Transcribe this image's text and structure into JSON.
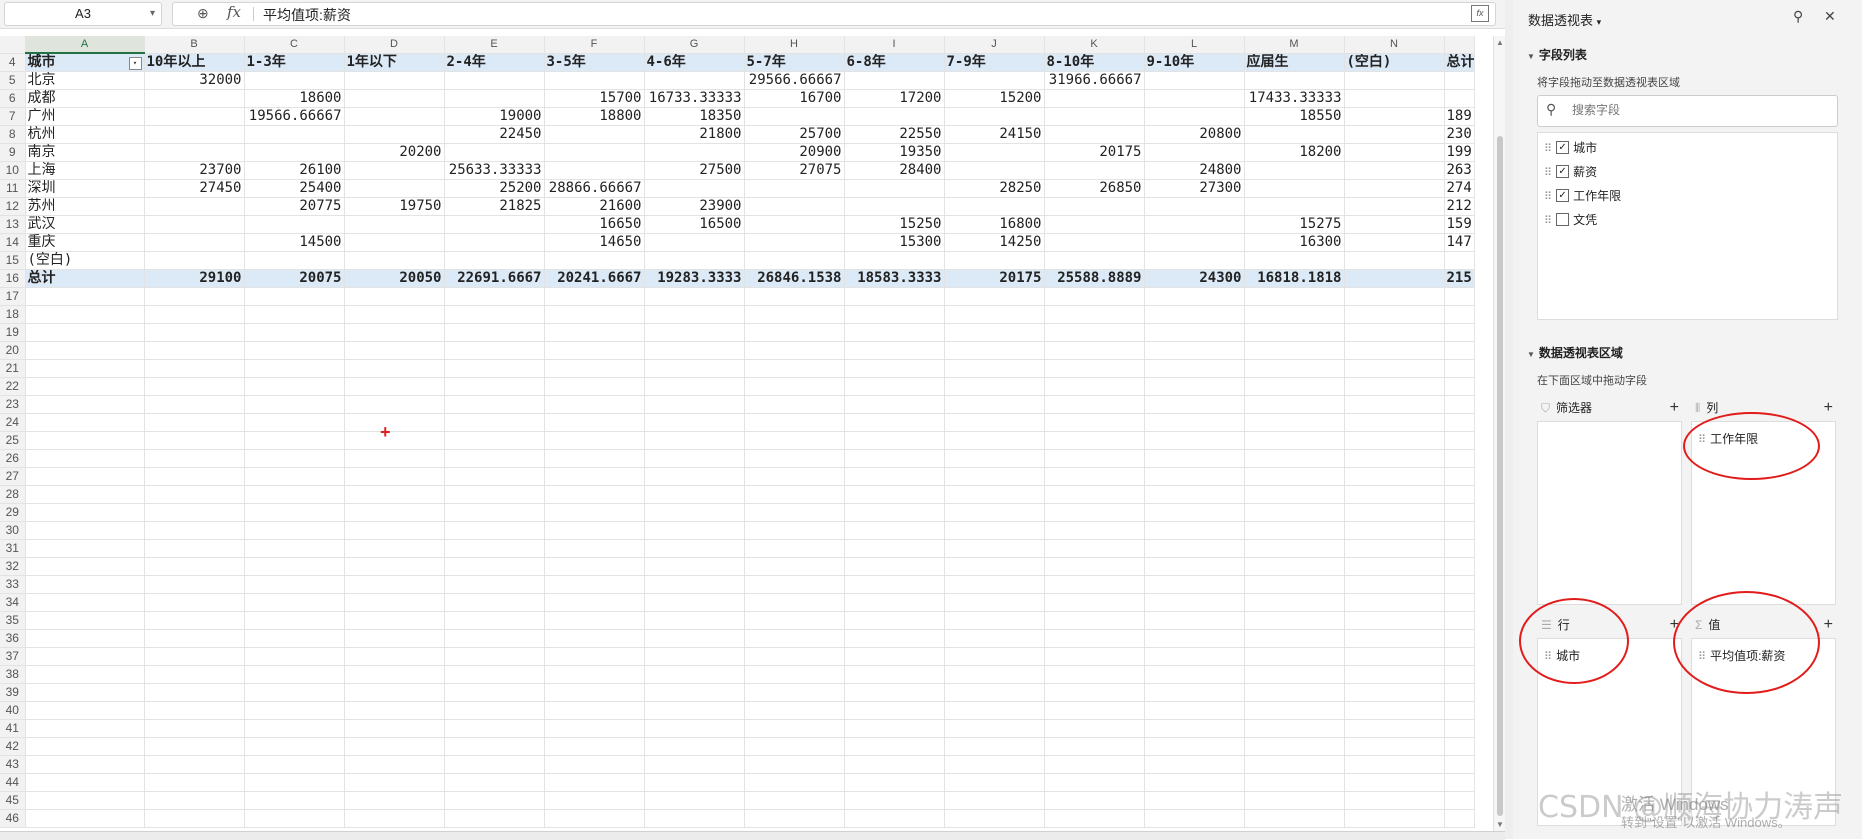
{
  "formula_bar": {
    "cell_ref": "A3",
    "formula": "平均值项:薪资"
  },
  "columns": [
    "A",
    "B",
    "C",
    "D",
    "E",
    "F",
    "G",
    "H",
    "I",
    "J",
    "K",
    "L",
    "M",
    "N",
    ""
  ],
  "pivot": {
    "header_row": "4",
    "headers": [
      "城市",
      "10年以上",
      "1-3年",
      "1年以下",
      "2-4年",
      "3-5年",
      "4-6年",
      "5-7年",
      "6-8年",
      "7-9年",
      "8-10年",
      "9-10年",
      "应届生",
      "(空白)",
      "总计"
    ],
    "rows": [
      {
        "n": "5",
        "cells": [
          "北京",
          "32000",
          "",
          "",
          "",
          "",
          "",
          "29566.66667",
          "",
          "",
          "31966.66667",
          "",
          "",
          "",
          ""
        ]
      },
      {
        "n": "6",
        "cells": [
          "成都",
          "",
          "18600",
          "",
          "",
          "15700",
          "16733.33333",
          "16700",
          "17200",
          "15200",
          "",
          "",
          "17433.33333",
          "",
          ""
        ]
      },
      {
        "n": "7",
        "cells": [
          "广州",
          "",
          "19566.66667",
          "",
          "19000",
          "18800",
          "18350",
          "",
          "",
          "",
          "",
          "",
          "18550",
          "",
          "189"
        ]
      },
      {
        "n": "8",
        "cells": [
          "杭州",
          "",
          "",
          "",
          "22450",
          "",
          "21800",
          "25700",
          "22550",
          "24150",
          "",
          "20800",
          "",
          "",
          "230"
        ]
      },
      {
        "n": "9",
        "cells": [
          "南京",
          "",
          "",
          "20200",
          "",
          "",
          "",
          "20900",
          "19350",
          "",
          "20175",
          "",
          "18200",
          "",
          "199"
        ]
      },
      {
        "n": "10",
        "cells": [
          "上海",
          "23700",
          "26100",
          "",
          "25633.33333",
          "",
          "27500",
          "27075",
          "28400",
          "",
          "",
          "24800",
          "",
          "",
          "263"
        ]
      },
      {
        "n": "11",
        "cells": [
          "深圳",
          "27450",
          "25400",
          "",
          "25200",
          "28866.66667",
          "",
          "",
          "",
          "28250",
          "26850",
          "27300",
          "",
          "",
          "274"
        ]
      },
      {
        "n": "12",
        "cells": [
          "苏州",
          "",
          "20775",
          "19750",
          "21825",
          "21600",
          "23900",
          "",
          "",
          "",
          "",
          "",
          "",
          "",
          "212"
        ]
      },
      {
        "n": "13",
        "cells": [
          "武汉",
          "",
          "",
          "",
          "",
          "16650",
          "16500",
          "",
          "15250",
          "16800",
          "",
          "",
          "15275",
          "",
          "159"
        ]
      },
      {
        "n": "14",
        "cells": [
          "重庆",
          "",
          "14500",
          "",
          "",
          "14650",
          "",
          "",
          "15300",
          "14250",
          "",
          "",
          "16300",
          "",
          "147"
        ]
      },
      {
        "n": "15",
        "cells": [
          "(空白)",
          "",
          "",
          "",
          "",
          "",
          "",
          "",
          "",
          "",
          "",
          "",
          "",
          "",
          ""
        ]
      }
    ],
    "total": {
      "n": "16",
      "cells": [
        "总计",
        "29100",
        "20075",
        "20050",
        "22691.6667",
        "20241.6667",
        "19283.3333",
        "26846.1538",
        "18583.3333",
        "20175",
        "25588.8889",
        "24300",
        "16818.1818",
        "",
        "215"
      ]
    },
    "empty_rows": [
      "17",
      "18",
      "19",
      "20",
      "21",
      "22",
      "23",
      "24",
      "25",
      "26",
      "27",
      "28",
      "29",
      "30",
      "31",
      "32",
      "33",
      "34",
      "35",
      "36",
      "37",
      "38",
      "39",
      "40",
      "41",
      "42",
      "43",
      "44",
      "45",
      "46"
    ]
  },
  "panel": {
    "title": "数据透视表",
    "field_list_title": "字段列表",
    "field_list_hint": "将字段拖动至数据透视表区域",
    "search_placeholder": "搜索字段",
    "fields": [
      {
        "label": "城市",
        "checked": true
      },
      {
        "label": "薪资",
        "checked": true
      },
      {
        "label": "工作年限",
        "checked": true
      },
      {
        "label": "文凭",
        "checked": false
      }
    ],
    "areas_title": "数据透视表区域",
    "areas_hint": "在下面区域中拖动字段",
    "filter_label": "筛选器",
    "columns_label": "列",
    "rows_label": "行",
    "values_label": "值",
    "columns_item": "工作年限",
    "rows_item": "城市",
    "values_item": "平均值项:薪资"
  },
  "overlay": {
    "watermark": "CSDN @顺海协力涛声",
    "activate_title": "激活 Windows",
    "activate_sub": "转到\"设置\"以激活 Windows。"
  },
  "icons": [
    "chevron-down-icon",
    "zoom-icon",
    "fx-icon",
    "insert-function-icon",
    "filter-dropdown-icon",
    "cursor-cross-icon",
    "pin-icon",
    "close-icon",
    "search-icon",
    "drag-handle-icon",
    "checkbox-icon",
    "filter-icon",
    "columns-icon",
    "rows-icon",
    "sigma-icon",
    "plus-icon"
  ],
  "colors": {
    "accent_green": "#217346",
    "total_band": "#dce9f6",
    "annotation_red": "#e21b1b"
  }
}
